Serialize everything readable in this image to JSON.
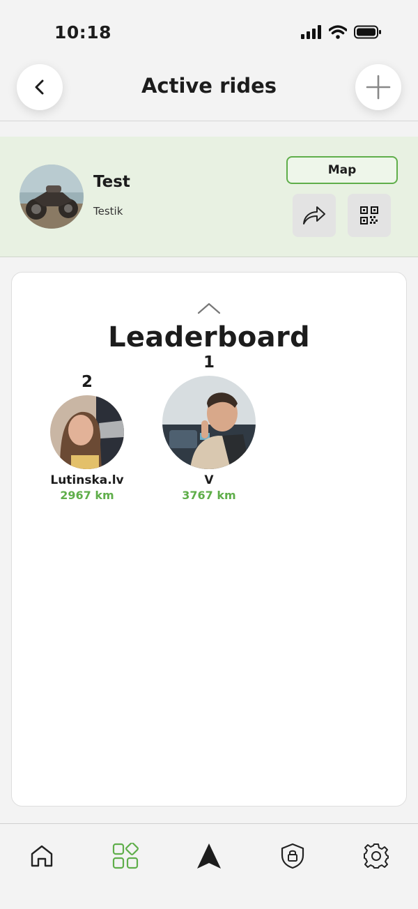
{
  "status_bar": {
    "time": "10:18",
    "icons": [
      "signal-icon",
      "wifi-icon",
      "battery-icon"
    ]
  },
  "header": {
    "title": "Active rides",
    "back_icon": "chevron-left-icon",
    "add_icon": "plus-icon"
  },
  "ride": {
    "name": "Test",
    "subtitle": "Testik",
    "map_label": "Map",
    "share_icon": "share-arrow-icon",
    "qr_icon": "qr-code-icon"
  },
  "leaderboard": {
    "title": "Leaderboard",
    "collapse_icon": "chevron-up-icon",
    "leaders": [
      {
        "rank": "1",
        "name": "V",
        "distance": "3767 km"
      },
      {
        "rank": "2",
        "name": "Lutinska.lv",
        "distance": "2967 km"
      }
    ]
  },
  "bottom_nav": {
    "items": [
      "home-icon",
      "dashboard-icon",
      "navigation-arrow-icon",
      "shield-lock-icon",
      "gear-icon"
    ],
    "active": "dashboard-icon"
  },
  "colors": {
    "accent": "#5fae4a",
    "ride_card_bg": "#e8f1e2",
    "background": "#f3f3f3"
  }
}
